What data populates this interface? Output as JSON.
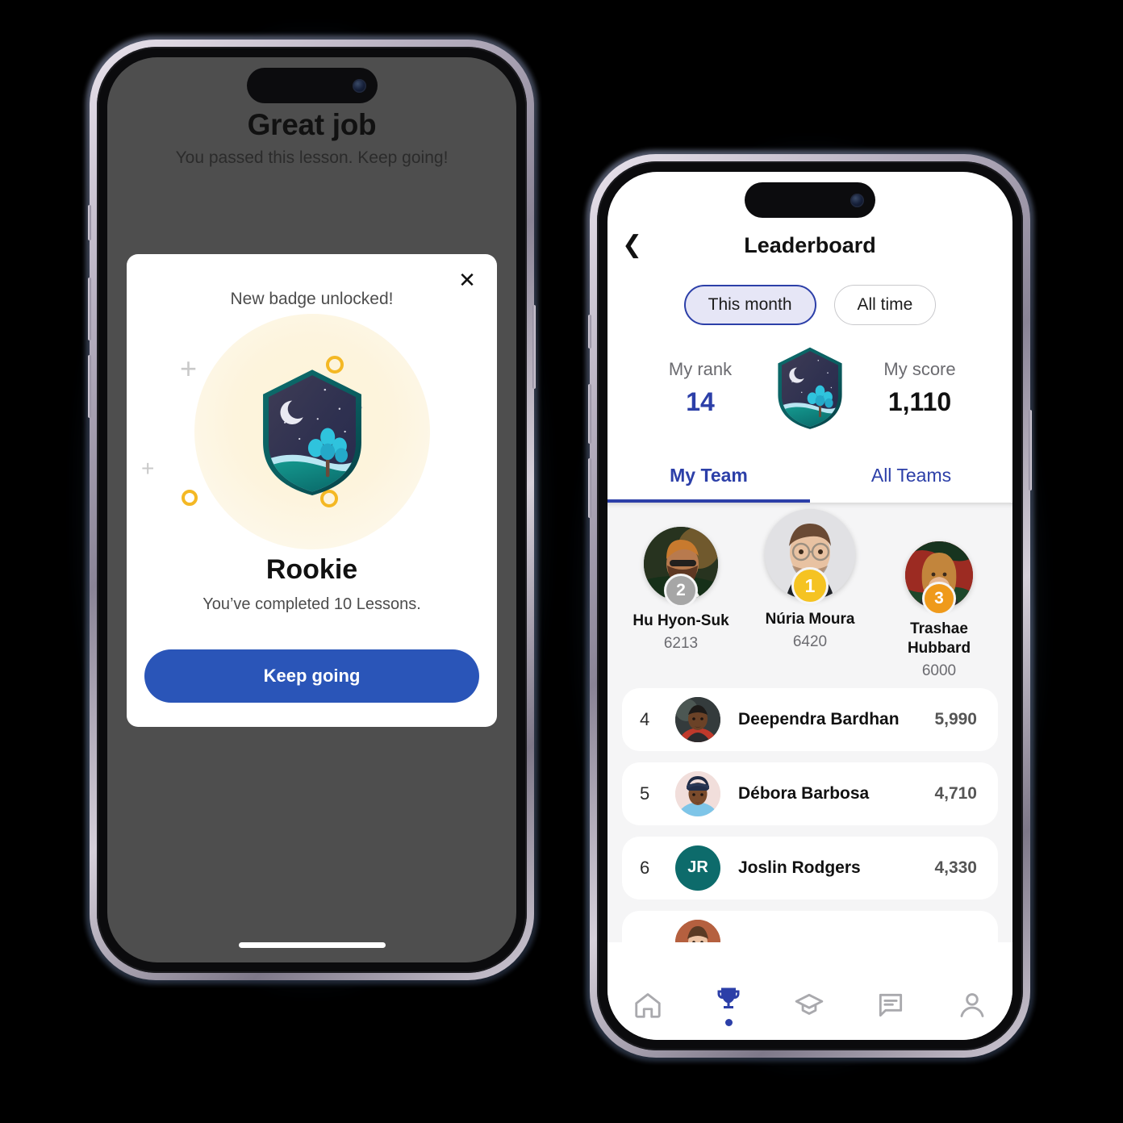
{
  "left_phone": {
    "headline": "Great job",
    "subtitle": "You passed this lesson. Keep going!",
    "modal": {
      "close_icon": "close-icon",
      "kicker": "New badge unlocked!",
      "badge_name": "Rookie",
      "badge_description": "You’ve completed 10 Lessons.",
      "cta_label": "Keep going",
      "badge_icon": "night-shield-badge-icon"
    },
    "overlay_color": "#4e4e4e",
    "accent_color": "#2a55b8",
    "glow_color": "#fdf4dd",
    "ring_color": "#f4b824"
  },
  "right_phone": {
    "header": {
      "back_icon": "chevron-left-icon",
      "title": "Leaderboard"
    },
    "period_filter": {
      "options": [
        "This month",
        "All time"
      ],
      "selected": "This month"
    },
    "stats": {
      "rank_label": "My rank",
      "rank_value": "14",
      "score_label": "My score",
      "score_value": "1,110",
      "badge_icon": "night-shield-badge-icon"
    },
    "tabs": {
      "items": [
        "My Team",
        "All Teams"
      ],
      "selected": "My Team"
    },
    "podium": [
      {
        "place": "2",
        "name": "Hu Hyon-Suk",
        "score": "6213",
        "medal_color": "#a6a6a6"
      },
      {
        "place": "1",
        "name": "Núria Moura",
        "score": "6420",
        "medal_color": "#f5c322"
      },
      {
        "place": "3",
        "name": "Trashae Hubbard",
        "score": "6000",
        "medal_color": "#ef9a1b"
      }
    ],
    "rows": [
      {
        "rank": "4",
        "name": "Deependra Bardhan",
        "score": "5,990",
        "initials": ""
      },
      {
        "rank": "5",
        "name": "Débora Barbosa",
        "score": "4,710",
        "initials": ""
      },
      {
        "rank": "6",
        "name": "Joslin Rodgers",
        "score": "4,330",
        "initials": "JR"
      }
    ],
    "nav": {
      "items": [
        {
          "icon": "home-icon",
          "active": false
        },
        {
          "icon": "trophy-icon",
          "active": true
        },
        {
          "icon": "graduation-cap-icon",
          "active": false
        },
        {
          "icon": "chat-icon",
          "active": false
        },
        {
          "icon": "person-icon",
          "active": false
        }
      ],
      "active_color": "#2c3fa8",
      "inactive_color": "#a9a9ad"
    },
    "accent_color": "#2c3fa8",
    "list_background": "#f5f5f6"
  }
}
